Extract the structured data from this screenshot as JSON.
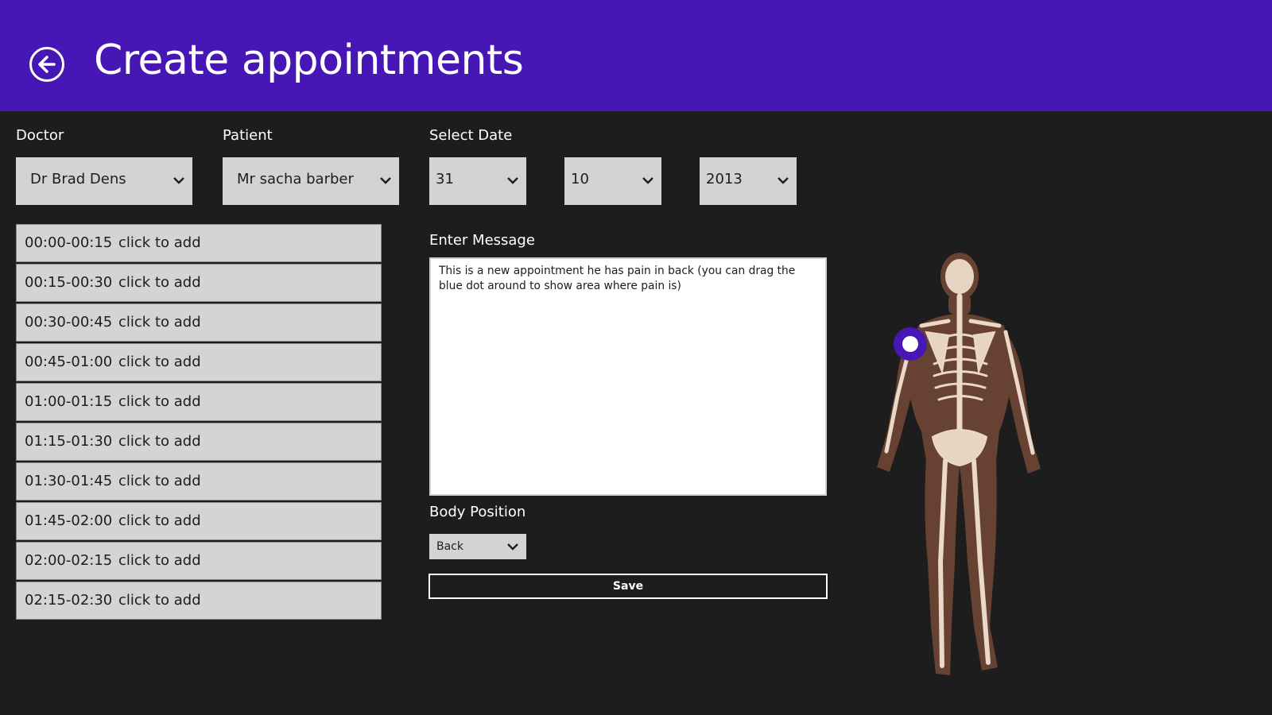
{
  "header": {
    "title": "Create appointments",
    "background": "#4617b5"
  },
  "doctor": {
    "label": "Doctor",
    "value": "Dr Brad Dens"
  },
  "patient": {
    "label": "Patient",
    "value": "Mr sacha barber"
  },
  "date": {
    "label": "Select Date",
    "day": "31",
    "month": "10",
    "year": "2013"
  },
  "slots": [
    {
      "time": "00:00-00:15",
      "action": "click to add"
    },
    {
      "time": "00:15-00:30",
      "action": "click to add"
    },
    {
      "time": "00:30-00:45",
      "action": "click to add"
    },
    {
      "time": "00:45-01:00",
      "action": "click to add"
    },
    {
      "time": "01:00-01:15",
      "action": "click to add"
    },
    {
      "time": "01:15-01:30",
      "action": "click to add"
    },
    {
      "time": "01:30-01:45",
      "action": "click to add"
    },
    {
      "time": "01:45-02:00",
      "action": "click to add"
    },
    {
      "time": "02:00-02:15",
      "action": "click to add"
    },
    {
      "time": "02:15-02:30",
      "action": "click to add"
    }
  ],
  "message": {
    "label": "Enter Message",
    "value": "This is a new appointment he has pain in back (you can drag the blue dot around to show area where pain is)"
  },
  "body_position": {
    "label": "Body Position",
    "value": "Back"
  },
  "save": {
    "label": "Save"
  },
  "icons": {
    "back": "back-arrow-icon",
    "chevron": "chevron-down-icon",
    "figure": "human-skeleton-back-view",
    "marker": "pain-location-dot"
  }
}
